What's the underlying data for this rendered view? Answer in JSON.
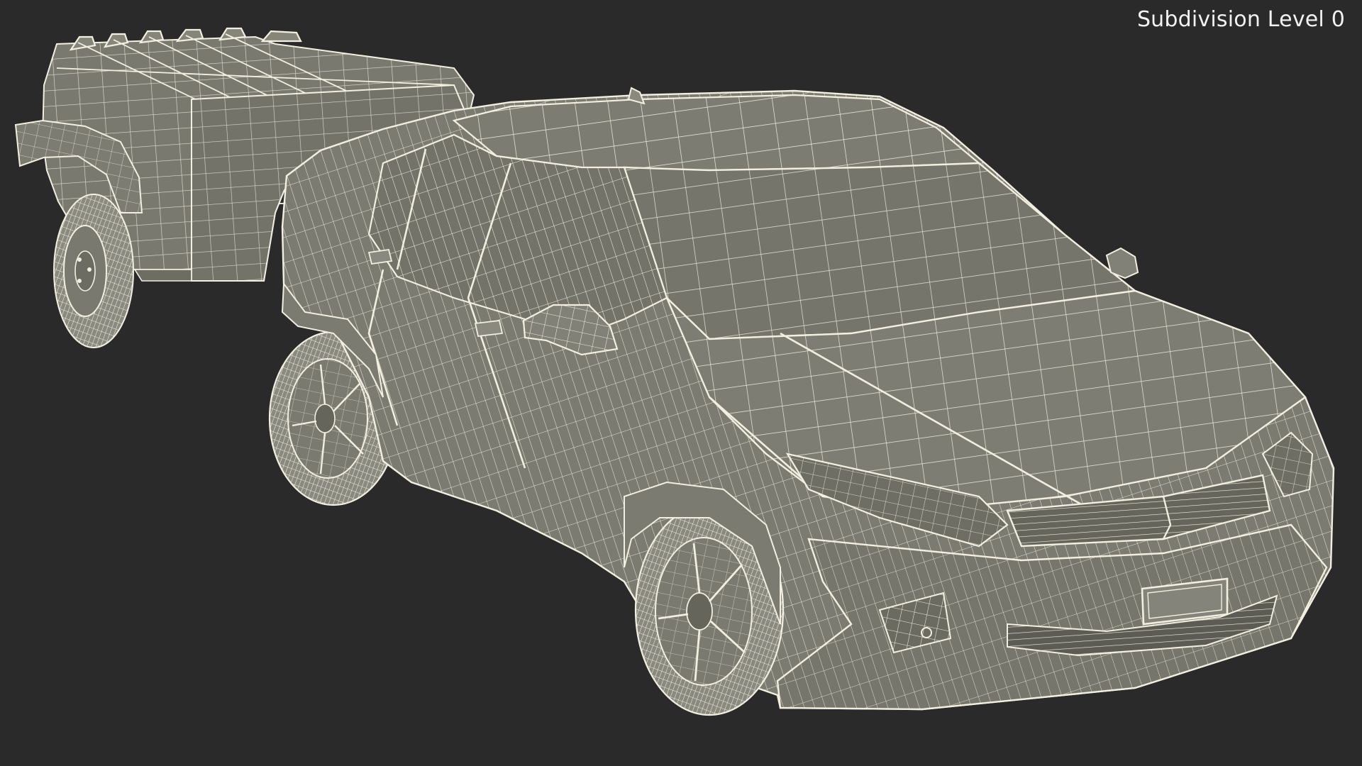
{
  "viewport": {
    "overlay_label": "Subdivision Level 0",
    "background_color": "#2a2a2a",
    "mesh_fill_color": "#7b7a70",
    "wire_color": "#f4f1e2",
    "shading": "wireframe-on-shaded"
  },
  "scene": {
    "objects": [
      {
        "name": "compact-hatchback-car"
      },
      {
        "name": "camping-trailer"
      }
    ]
  }
}
